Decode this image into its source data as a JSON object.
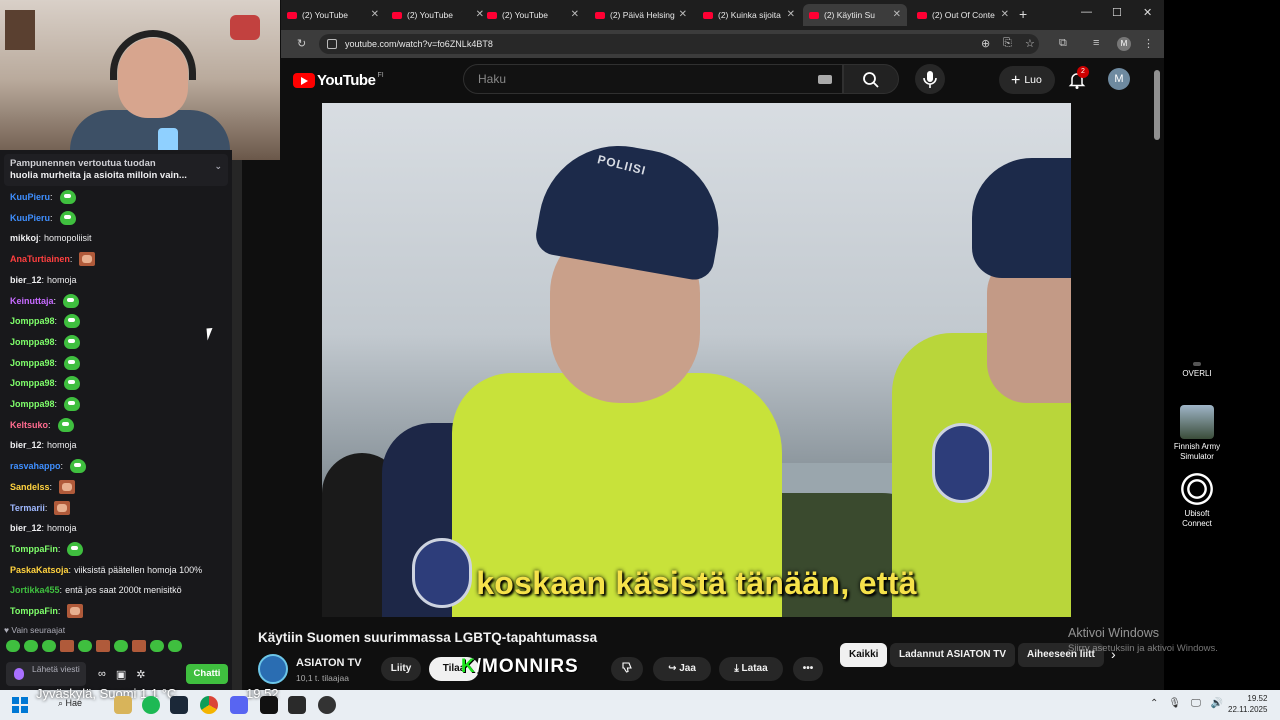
{
  "stream": {
    "pinned_text": "huolia murheita ja asioita milloin vain...",
    "pinned_text_top": "Pampunennen vertoutua tuodan",
    "messages": [
      {
        "user": "KuuPieru",
        "color": "#3f8fff",
        "text": "",
        "emote": "pepe"
      },
      {
        "user": "KuuPieru",
        "color": "#3f8fff",
        "text": "",
        "emote": "pepe"
      },
      {
        "user": "mikkoj",
        "color": "#efeff1",
        "text": "homopoliisit",
        "emote": ""
      },
      {
        "user": "AnaTurtiainen",
        "color": "#ff3f3f",
        "text": "",
        "emote": "face"
      },
      {
        "user": "bier_12",
        "color": "#efeff1",
        "text": "homoja",
        "emote": ""
      },
      {
        "user": "Keinuttaja",
        "color": "#c66bff",
        "text": "",
        "emote": "pepe"
      },
      {
        "user": "Jomppa98",
        "color": "#7fff6b",
        "text": "",
        "emote": "pepe"
      },
      {
        "user": "Jomppa98",
        "color": "#7fff6b",
        "text": "",
        "emote": "pepe"
      },
      {
        "user": "Jomppa98",
        "color": "#7fff6b",
        "text": "",
        "emote": "pepe"
      },
      {
        "user": "Jomppa98",
        "color": "#7fff6b",
        "text": "",
        "emote": "pepe"
      },
      {
        "user": "Jomppa98",
        "color": "#7fff6b",
        "text": "",
        "emote": "pepe"
      },
      {
        "user": "Keltsuko",
        "color": "#ff6b8f",
        "text": "",
        "emote": "pepe"
      },
      {
        "user": "bier_12",
        "color": "#efeff1",
        "text": "homoja",
        "emote": ""
      },
      {
        "user": "rasvahappo",
        "color": "#3f8fff",
        "text": "",
        "emote": "pepe"
      },
      {
        "user": "Sandelss",
        "color": "#ffd23f",
        "text": "",
        "emote": "face"
      },
      {
        "user": "Termarii",
        "color": "#9fb8ff",
        "text": "",
        "emote": "face"
      },
      {
        "user": "bier_12",
        "color": "#efeff1",
        "text": "homoja",
        "emote": ""
      },
      {
        "user": "TomppaFin",
        "color": "#7fff6b",
        "text": "",
        "emote": "pepe"
      },
      {
        "user": "PaskaKatsoja",
        "color": "#ffd23f",
        "text": "viiksistä päätellen homoja 100%",
        "emote": ""
      },
      {
        "user": "Jortikka455",
        "color": "#3fbf3f",
        "text": "entä jos saat 2000t menisitkö",
        "emote": ""
      },
      {
        "user": "TomppaFin",
        "color": "#7fff6b",
        "text": "",
        "emote": "face"
      }
    ],
    "follower_mode": "♥ Vain seuraajat",
    "input_placeholder": "Lähetä viesti",
    "send_label": "Chatti"
  },
  "browser": {
    "tabs": [
      {
        "label": "(2) YouTube",
        "active": false
      },
      {
        "label": "(2) YouTube",
        "active": false
      },
      {
        "label": "(2) YouTube",
        "active": false
      },
      {
        "label": "(2) Päivä Helsing",
        "active": false
      },
      {
        "label": "(2) Kuinka sijoita",
        "active": false
      },
      {
        "label": "(2) Käytiin Su",
        "active": true
      },
      {
        "label": "(2) Out Of Conte",
        "active": false
      }
    ],
    "url": "youtube.com/watch?v=fo6ZNLk4BT8",
    "profile_initial": "M"
  },
  "youtube": {
    "logo_text": "YouTube",
    "region": "FI",
    "search_placeholder": "Haku",
    "create_label": "Luo",
    "notification_count": "2",
    "avatar_initial": "M",
    "subtitle": "koskaan käsistä tänään, että",
    "video_title": "Käytiin Suomen suurimmassa LGBTQ-tapahtumassa",
    "channel_name": "ASIATON TV",
    "subscribers": "10,1 t. tilaajaa",
    "join_label": "Liity",
    "subscribe_label": "Tilaa",
    "share_label": "Jaa",
    "download_label": "Lataa",
    "more_label": "•••",
    "chips": [
      "Kaikki",
      "Ladannut ASIATON TV",
      "Aiheeseen liitt"
    ],
    "overlay_logo_k": "K",
    "overlay_logo_rest": "/MONNIRS"
  },
  "desktop": {
    "icons": [
      {
        "label": "OVERLI"
      },
      {
        "label": "Finnish Army Simulator"
      },
      {
        "label": "Ubisoft Connect"
      }
    ],
    "activate_title": "Aktivoi Windows",
    "activate_sub": "Siirry asetuksiin ja aktivoi Windows."
  },
  "taskbar": {
    "weather": "Jyväskylä, Suomi   1,1 °C",
    "search_label": "Hae",
    "time": "19.52",
    "date": "22.11.2025",
    "overlay_time": "19.52"
  },
  "colors": {
    "yt_red": "#ff0000",
    "twitch_green": "#3fbf3f",
    "subtitle_yellow": "#f6e24a"
  }
}
